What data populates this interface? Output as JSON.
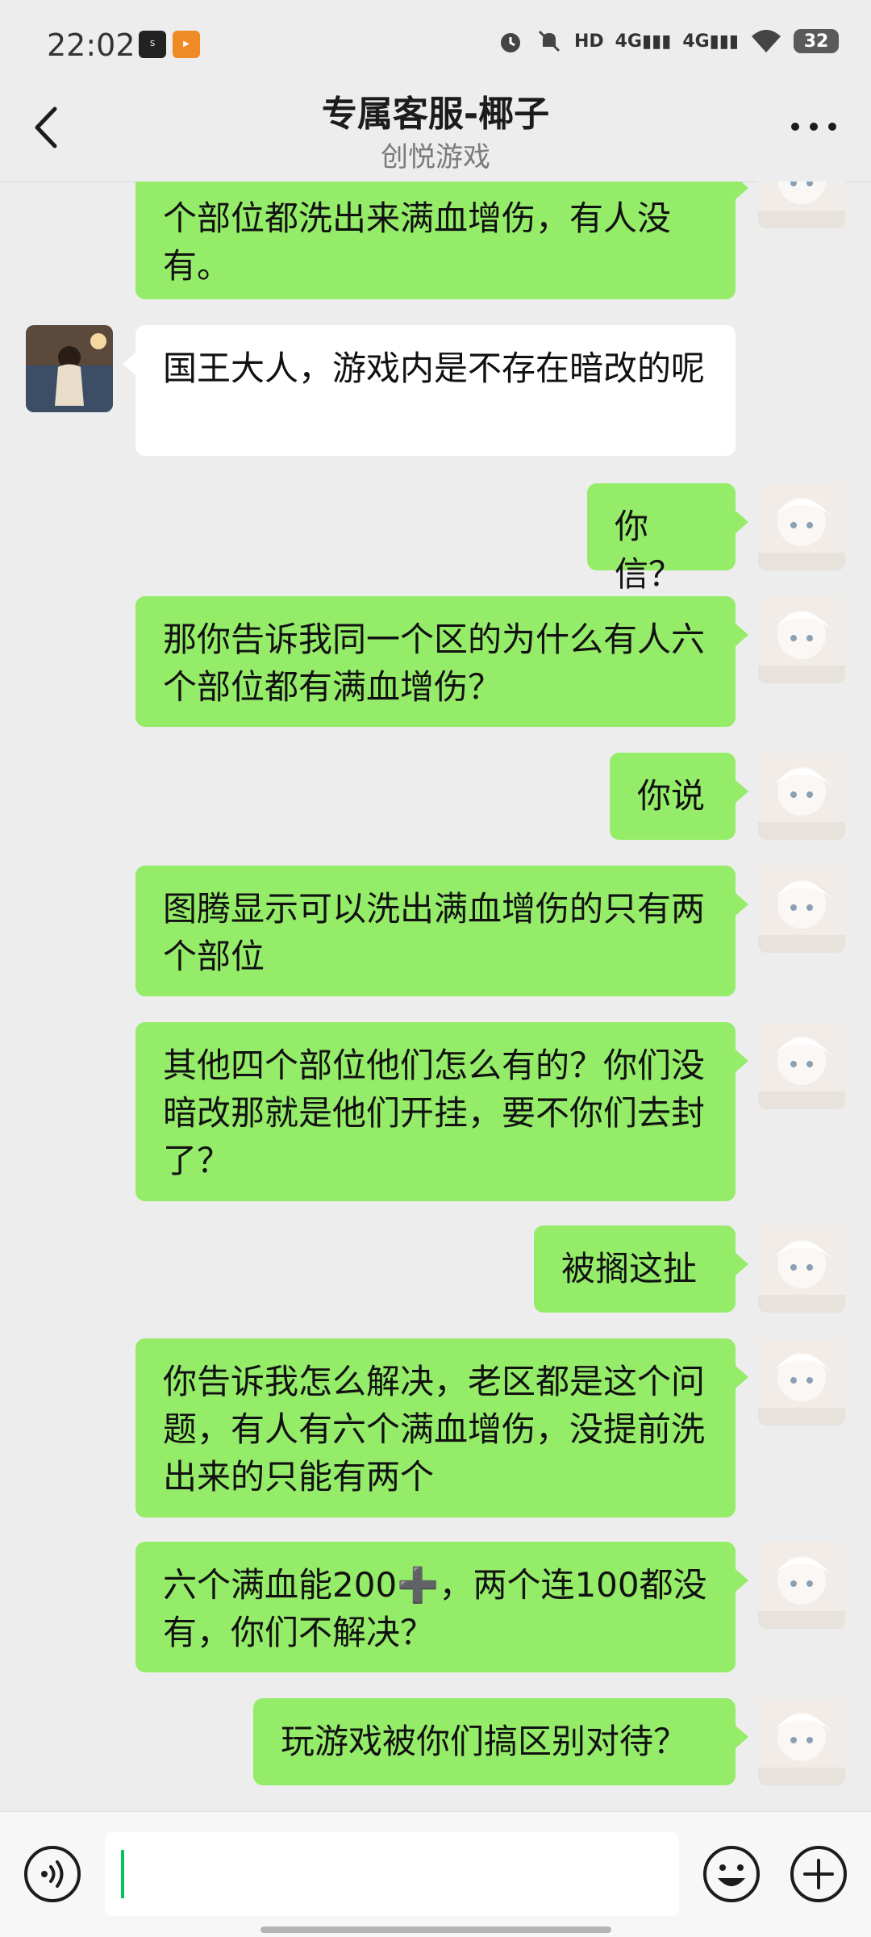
{
  "status_bar": {
    "time": "22:02",
    "battery": "32"
  },
  "header": {
    "title": "专属客服-椰子",
    "subtitle": "创悦游戏"
  },
  "messages": [
    {
      "from": "me",
      "text": "个部位都洗出来满血增伤，有人没有。"
    },
    {
      "from": "other",
      "text": "国王大人，游戏内是不存在暗改的呢"
    },
    {
      "from": "me",
      "text": "你信？"
    },
    {
      "from": "me",
      "text": "那你告诉我同一个区的为什么有人六个部位都有满血增伤？"
    },
    {
      "from": "me",
      "text": "你说"
    },
    {
      "from": "me",
      "text": "图腾显示可以洗出满血增伤的只有两个部位"
    },
    {
      "from": "me",
      "text": "其他四个部位他们怎么有的？你们没暗改那就是他们开挂，要不你们去封了？"
    },
    {
      "from": "me",
      "text": "被搁这扯"
    },
    {
      "from": "me",
      "text": "你告诉我怎么解决，老区都是这个问题，有人有六个满血增伤，没提前洗出来的只能有两个"
    },
    {
      "from": "me",
      "text": "六个满血能200➕，两个连100都没有，你们不解决？"
    },
    {
      "from": "me",
      "text": "玩游戏被你们搞区别对待？"
    }
  ],
  "colors": {
    "my_bubble": "#95ec69",
    "other_bubble": "#ffffff",
    "background": "#ededed"
  }
}
